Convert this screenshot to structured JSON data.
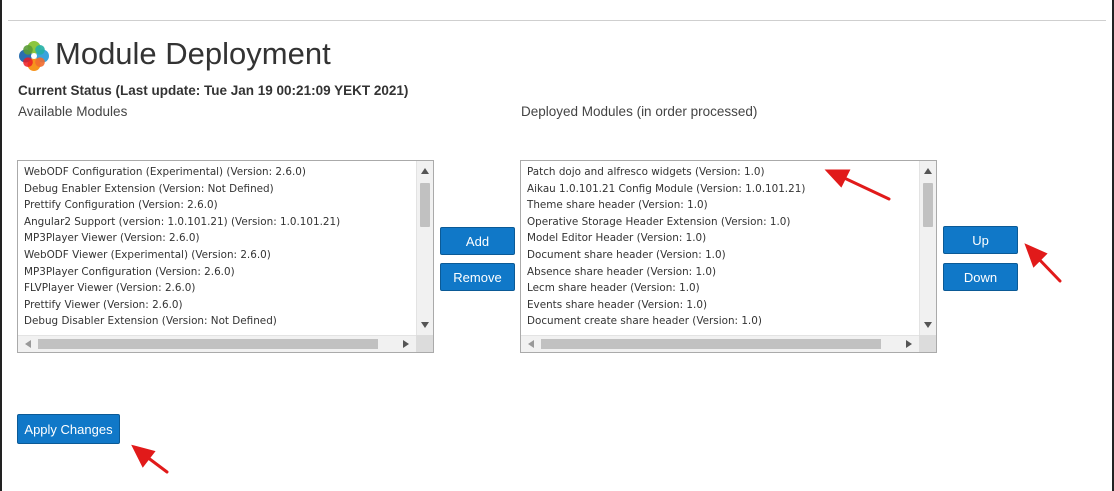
{
  "page": {
    "title": "Module Deployment",
    "status": "Current Status (Last update: Tue Jan 19 00:21:09 YEKT 2021)"
  },
  "available": {
    "label": "Available Modules",
    "items": [
      "WebODF Configuration (Experimental) (Version: 2.6.0)",
      "Debug Enabler Extension (Version: Not Defined)",
      "Prettify Configuration (Version: 2.6.0)",
      "Angular2 Support (version: 1.0.101.21) (Version: 1.0.101.21)",
      "MP3Player Viewer (Version: 2.6.0)",
      "WebODF Viewer (Experimental) (Version: 2.6.0)",
      "MP3Player Configuration (Version: 2.6.0)",
      "FLVPlayer Viewer (Version: 2.6.0)",
      "Prettify Viewer (Version: 2.6.0)",
      "Debug Disabler Extension (Version: Not Defined)"
    ]
  },
  "deployed": {
    "label": "Deployed Modules (in order processed)",
    "items": [
      "Patch dojo and alfresco widgets (Version: 1.0)",
      "Aikau 1.0.101.21 Config Module (Version: 1.0.101.21)",
      "Theme share header (Version: 1.0)",
      "Operative Storage Header Extension (Version: 1.0)",
      "Model Editor Header (Version: 1.0)",
      "Document share header (Version: 1.0)",
      "Absence share header (Version: 1.0)",
      "Lecm share header (Version: 1.0)",
      "Events share header (Version: 1.0)",
      "Document create share header (Version: 1.0)"
    ]
  },
  "buttons": {
    "add": "Add",
    "remove": "Remove",
    "up": "Up",
    "down": "Down",
    "apply": "Apply Changes"
  },
  "icons": {
    "logo": "alfresco-flower-logo",
    "annotation": "red-arrow-icon"
  },
  "colors": {
    "button": "#1078c8",
    "annotation": "#e11a1a"
  }
}
